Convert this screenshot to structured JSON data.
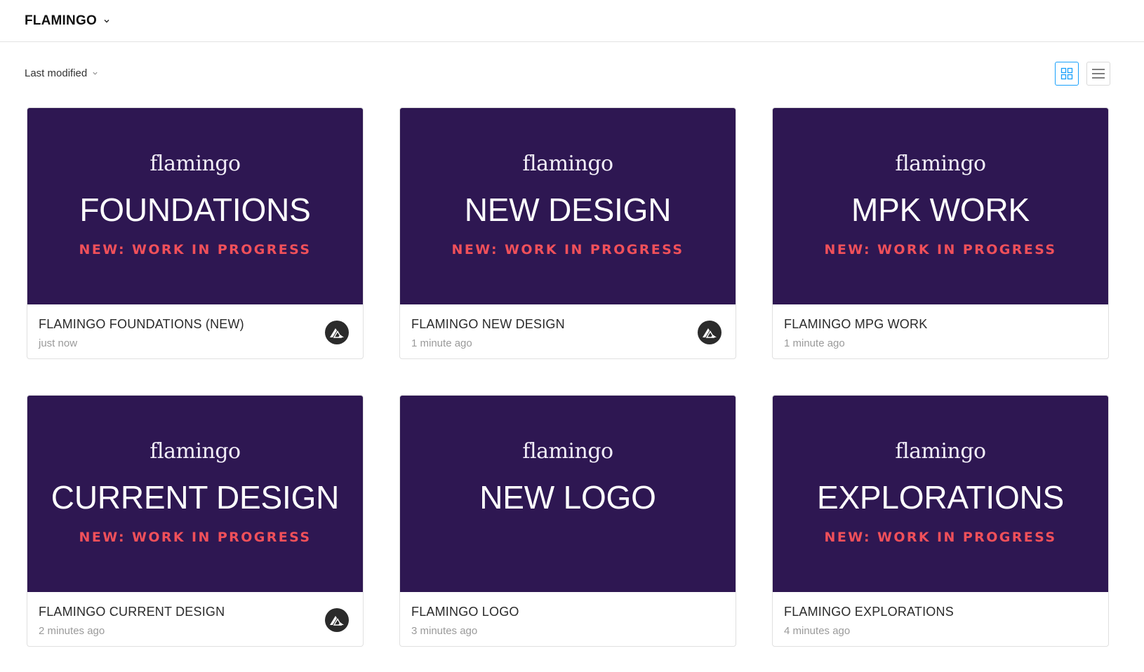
{
  "header": {
    "project_name": "FLAMINGO"
  },
  "toolbar": {
    "sort_label": "Last modified"
  },
  "colors": {
    "thumbnail_bg": "#2e1752",
    "accent_red": "#f0505a",
    "selected_blue": "#18a0fb"
  },
  "files": [
    {
      "brand": "flamingo",
      "heading": "FOUNDATIONS",
      "tag": "NEW: WORK IN PROGRESS",
      "name": "FLAMINGO FOUNDATIONS (NEW)",
      "modified": "just now"
    },
    {
      "brand": "flamingo",
      "heading": "NEW DESIGN",
      "tag": "NEW: WORK IN PROGRESS",
      "name": "FLAMINGO NEW DESIGN",
      "modified": "1 minute ago"
    },
    {
      "brand": "flamingo",
      "heading": "MPK WORK",
      "tag": "NEW: WORK IN PROGRESS",
      "name": "FLAMINGO MPG WORK",
      "modified": "1 minute ago"
    },
    {
      "brand": "flamingo",
      "heading": "CURRENT DESIGN",
      "tag": "NEW: WORK IN PROGRESS",
      "name": "FLAMINGO CURRENT DESIGN",
      "modified": "2 minutes ago"
    },
    {
      "brand": "flamingo",
      "heading": "NEW LOGO",
      "tag": "",
      "name": "FLAMINGO LOGO",
      "modified": "3 minutes ago"
    },
    {
      "brand": "flamingo",
      "heading": "EXPLORATIONS",
      "tag": "NEW: WORK IN PROGRESS",
      "name": "FLAMINGO EXPLORATIONS",
      "modified": "4 minutes ago"
    }
  ]
}
